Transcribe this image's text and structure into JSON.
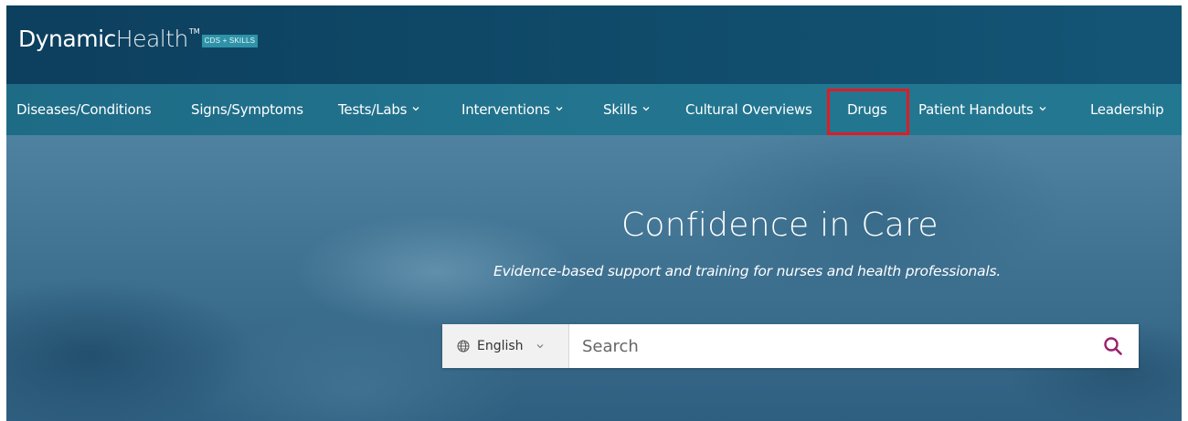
{
  "brand": {
    "word1": "Dynamic",
    "word2": "Health",
    "trademark": "TM",
    "badge": "CDS + SKILLS"
  },
  "nav": {
    "items": [
      {
        "label": "Diseases/Conditions",
        "has_dropdown": false
      },
      {
        "label": "Signs/Symptoms",
        "has_dropdown": false
      },
      {
        "label": "Tests/Labs",
        "has_dropdown": true
      },
      {
        "label": "Interventions",
        "has_dropdown": true
      },
      {
        "label": "Skills",
        "has_dropdown": true
      },
      {
        "label": "Cultural Overviews",
        "has_dropdown": false
      },
      {
        "label": "Drugs",
        "has_dropdown": false,
        "highlighted": true
      },
      {
        "label": "Patient Handouts",
        "has_dropdown": true
      },
      {
        "label": "Leadership",
        "has_dropdown": false
      }
    ]
  },
  "hero": {
    "title": "Confidence in Care",
    "subtitle": "Evidence-based support and training for nurses and health professionals."
  },
  "search": {
    "language": "English",
    "placeholder": "Search",
    "icon": "search-icon"
  },
  "colors": {
    "brand_bar": "#0f4867",
    "nav_bar": "#22748f",
    "highlight": "#e01b24",
    "search_icon": "#9c1f6e"
  }
}
